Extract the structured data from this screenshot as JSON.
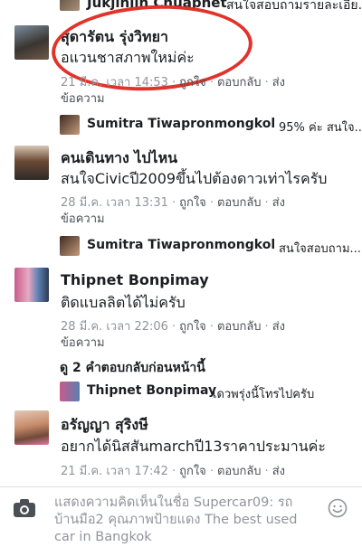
{
  "comments": [
    {
      "id": "top",
      "reply_name": "Jukjinjin Chuaphet",
      "reply_text": "สนใจสอบถามรายละเอีย..."
    },
    {
      "id": "c1",
      "name": "สุดารัตน รุ่งวิทยา",
      "text": "อแวนชาสภาพใหม่ค่ะ",
      "time": "21 มี.ค. เวลา 14:53",
      "like": "ถูกใจ",
      "reply": "ตอบกลับ",
      "send": "ส่ง",
      "send_msg": "ข้อความ",
      "reply_name": "Sumitra Tiwapronmongkol",
      "reply_text": "95% ค่ะ สนใจ..."
    },
    {
      "id": "c2",
      "name": "คนเดินทาง ไปไหน",
      "text": "สนใจCivicปี2009ขึ้นไปต้องดาวเท่าไรครับ",
      "time": "28 มี.ค. เวลา 13:31",
      "like": "ถูกใจ",
      "reply": "ตอบกลับ",
      "send": "ส่ง",
      "send_msg": "ข้อความ",
      "reply_name": "Sumitra Tiwapronmongkol",
      "reply_text": "สนใจสอบถาม..."
    },
    {
      "id": "c3",
      "name": "Thipnet Bonpimay",
      "text": "ติดแบลลิตได้ไม่ครับ",
      "time": "28 มี.ค. เวลา 22:06",
      "like": "ถูกใจ",
      "reply": "ตอบกลับ",
      "send": "ส่ง",
      "send_msg": "ข้อความ",
      "view_previous": "ดู 2 คำตอบกลับก่อนหน้านี้",
      "reply_name": "Thipnet Bonpimay",
      "reply_text": "เดวพรุ่งนี้โทรไปครับ"
    },
    {
      "id": "c4",
      "name": "อรัญญา สุริงษี",
      "text": "อยากได้นิสสันmarchปี13ราคาประมานค่ะ",
      "time": "21 มี.ค. เวลา 17:42",
      "like": "ถูกใจ",
      "reply": "ตอบกลับ",
      "send": "ส่ง"
    }
  ],
  "composer": {
    "placeholder": "แสดงความคิดเห็นในชื่อ Supercar09: รถบ้านมือ2 คุณภาพป้ายแดง The best used car in Bangkok"
  },
  "icons": {
    "camera": "camera-icon",
    "emoji": "smiley-icon"
  },
  "colors": {
    "highlight_circle": "#e0332b",
    "meta": "#90949c"
  }
}
